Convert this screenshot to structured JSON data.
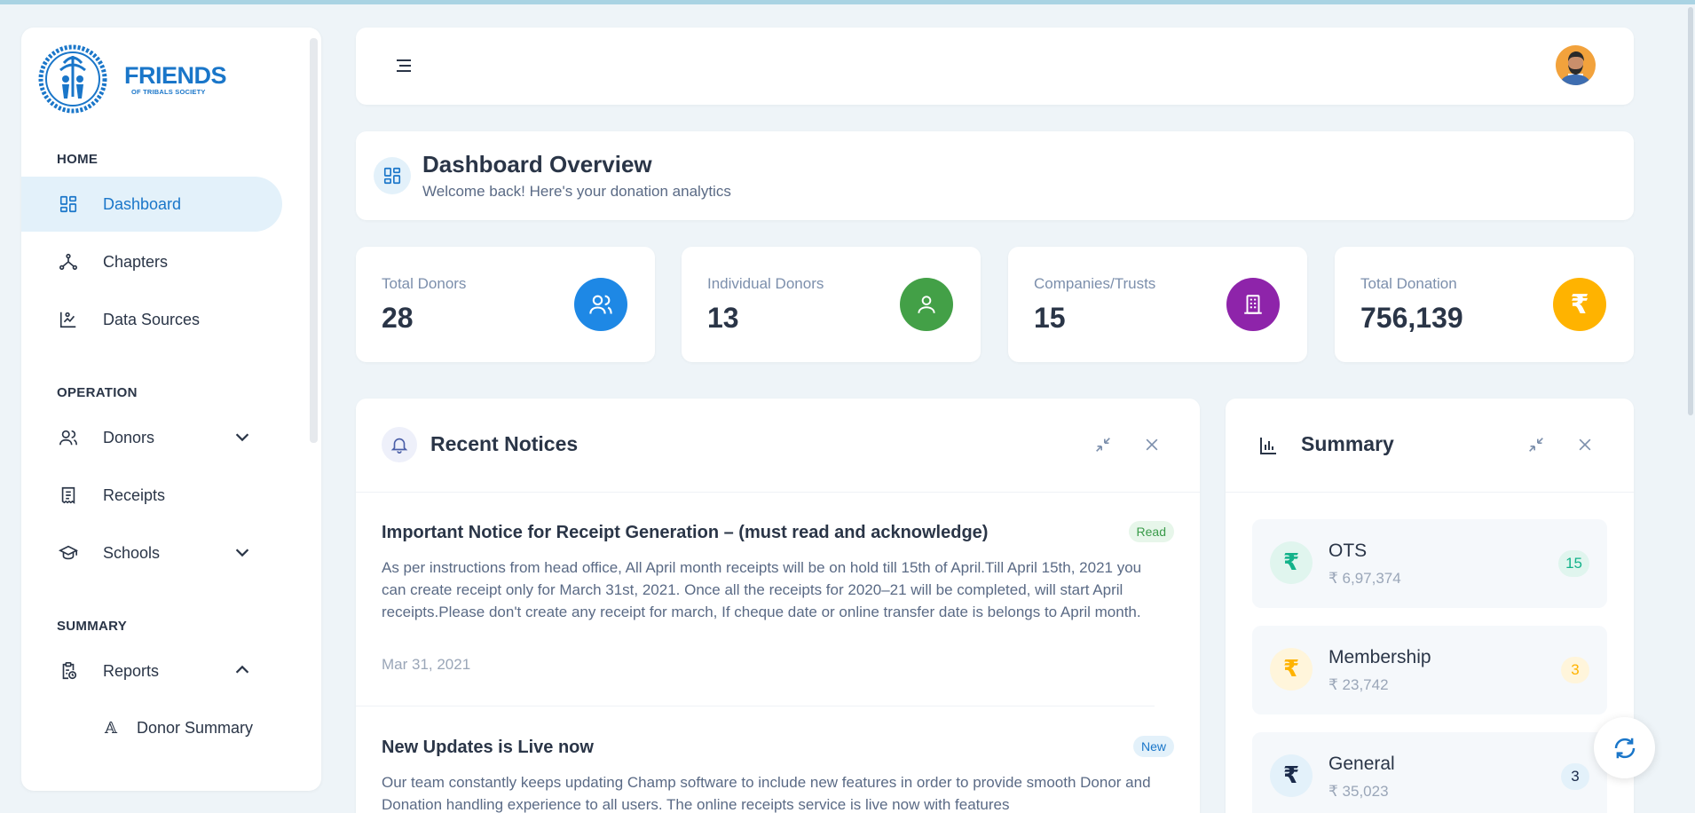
{
  "brand": {
    "name": "FRIENDS",
    "tagline": "OF TRIBALS SOCIETY",
    "accent": "#1a76c9"
  },
  "sidebar": {
    "sections": [
      {
        "title": "HOME"
      },
      {
        "title": "OPERATION"
      },
      {
        "title": "SUMMARY"
      }
    ],
    "items": [
      {
        "label": "Dashboard",
        "icon": "dashboard-icon"
      },
      {
        "label": "Chapters",
        "icon": "chapters-icon"
      },
      {
        "label": "Data Sources",
        "icon": "data-sources-icon"
      },
      {
        "label": "Donors",
        "icon": "users-icon"
      },
      {
        "label": "Receipts",
        "icon": "receipt-icon"
      },
      {
        "label": "Schools",
        "icon": "school-icon"
      },
      {
        "label": "Reports",
        "icon": "report-icon"
      }
    ],
    "subitems": [
      {
        "label": "Donor Summary",
        "icon_glyph": "𝔸"
      }
    ]
  },
  "overview": {
    "title": "Dashboard Overview",
    "subtitle": "Welcome back! Here's your donation analytics"
  },
  "stats": [
    {
      "label": "Total Donors",
      "value": "28",
      "color": "#1e88e5"
    },
    {
      "label": "Individual Donors",
      "value": "13",
      "color": "#43a047"
    },
    {
      "label": "Companies/Trusts",
      "value": "15",
      "color": "#8e24aa"
    },
    {
      "label": "Total Donation",
      "value": "756,139",
      "color": "#ffb300"
    }
  ],
  "notices": {
    "title": "Recent Notices",
    "items": [
      {
        "title": "Important Notice for Receipt Generation – (must read and acknowledge)",
        "badge": "Read",
        "body": "As per instructions from head office, All April month receipts will be on hold till 15th of April.Till April 15th, 2021 you can create receipt only for March 31st, 2021. Once all the receipts for 2020–21 will be completed, will start April receipts.Please don't create any receipt for march, If cheque date or online transfer date is belongs to April month.",
        "date": "Mar 31, 2021"
      },
      {
        "title": "New Updates is Live now",
        "badge": "New",
        "body": "Our team constantly keeps updating Champ software to include new features in order to provide smooth Donor and Donation handling experience to all users. The online receipts service is live now with features"
      }
    ]
  },
  "summary": {
    "title": "Summary",
    "items": [
      {
        "name": "OTS",
        "amount": "₹ 6,97,374",
        "count": "15",
        "symbol": "₹",
        "color": "#13b28a",
        "bg": "#e0f5ee"
      },
      {
        "name": "Membership",
        "amount": "₹ 23,742",
        "count": "3",
        "symbol": "₹",
        "color": "#ffb300",
        "bg": "#fff5db"
      },
      {
        "name": "General",
        "amount": "₹ 35,023",
        "count": "3",
        "symbol": "₹",
        "color": "#1a2a4a",
        "bg": "#e3f1fa"
      }
    ]
  }
}
